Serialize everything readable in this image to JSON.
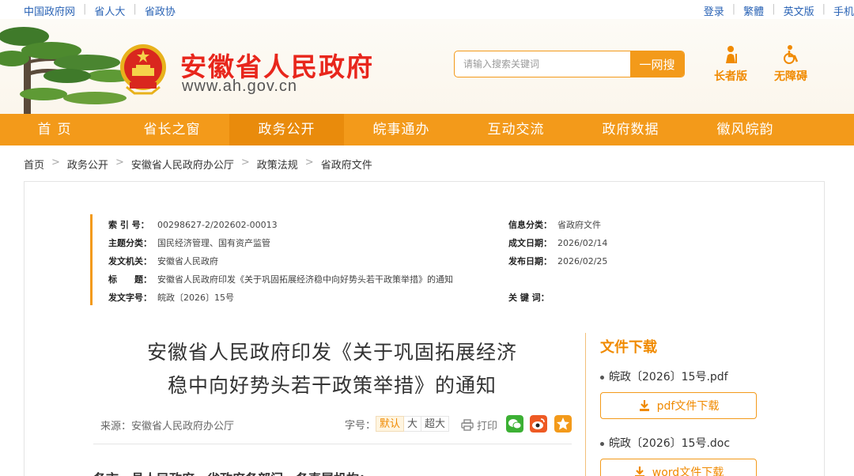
{
  "topbar": {
    "links_left": [
      "中国政府网",
      "省人大",
      "省政协"
    ],
    "links_right": [
      "登录",
      "繁體",
      "英文版",
      "手机"
    ]
  },
  "header": {
    "site_title": "安徽省人民政府",
    "site_url": "www.ah.gov.cn",
    "search_placeholder": "请输入搜索关键词",
    "search_button": "一网搜",
    "elder_mode": "长者版",
    "accessibility": "无障碍",
    "colors": {
      "brand_red": "#e8261c",
      "accent_orange": "#f39a1a"
    }
  },
  "nav": {
    "items": [
      "首页",
      "省长之窗",
      "政务公开",
      "皖事通办",
      "互动交流",
      "政府数据",
      "徽风皖韵"
    ],
    "active": "政务公开"
  },
  "breadcrumb": [
    "首页",
    "政务公开",
    "安徽省人民政府办公厅",
    "政策法规",
    "省政府文件"
  ],
  "meta": {
    "index_no_label": "索 引 号：",
    "index_no": "00298627-2/202602-00013",
    "topic_label": "主题分类：",
    "topic": "国民经济管理、国有资产监管",
    "issuer_label": "发文机关：",
    "issuer": "安徽省人民政府",
    "title_label": "标　　题：",
    "title": "安徽省人民政府印发《关于巩固拓展经济稳中向好势头若干政策举措》的通知",
    "doc_no_label": "发文字号：",
    "doc_no": "皖政〔2026〕15号",
    "info_cat_label": "信息分类：",
    "info_cat": "省政府文件",
    "created_label": "成文日期：",
    "created": "2026/02/14",
    "published_label": "发布日期：",
    "published": "2026/02/25",
    "keywords_label": "关 键 词：",
    "keywords": ""
  },
  "article": {
    "title_line1": "安徽省人民政府印发《关于巩固拓展经济",
    "title_line2": "稳中向好势头若干政策举措》的通知",
    "source": "来源：安徽省人民政府办公厅",
    "font_size_label": "字号：",
    "font_sizes": [
      "默认",
      "大",
      "超大"
    ],
    "print_label": "打印",
    "body_start": "各市、县人民政府，省政府各部门、各直属机构："
  },
  "downloads": {
    "title": "文件下载",
    "files": [
      {
        "name": "皖政〔2026〕15号.pdf",
        "button": "pdf文件下载"
      },
      {
        "name": "皖政〔2026〕15号.doc",
        "button": "word文件下载"
      }
    ]
  }
}
